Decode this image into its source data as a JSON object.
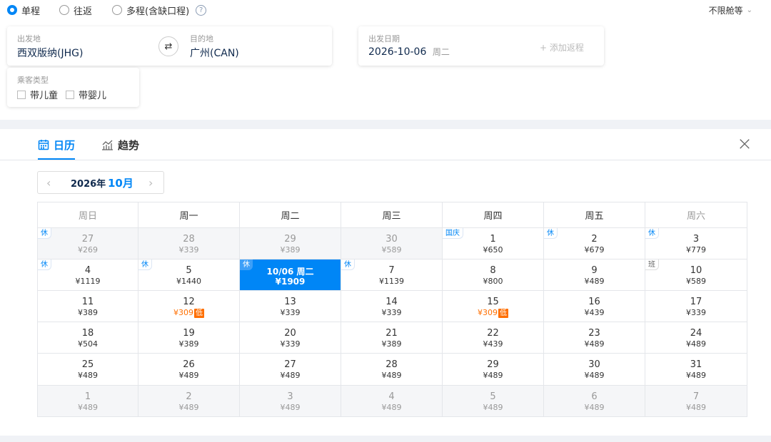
{
  "trip_types": [
    {
      "label": "单程",
      "selected": true
    },
    {
      "label": "往返",
      "selected": false
    },
    {
      "label": "多程(含缺口程)",
      "selected": false
    }
  ],
  "help_label": "?",
  "cabin_label": "不限舱等",
  "search": {
    "origin_label": "出发地",
    "origin": "西双版纳(JHG)",
    "dest_label": "目的地",
    "dest": "广州(CAN)",
    "date_label": "出发日期",
    "date": "2026-10-06",
    "date_weekday": "周二",
    "add_return": "+ 添加返程"
  },
  "passenger": {
    "label": "乘客类型",
    "child": "带儿童",
    "infant": "带婴儿"
  },
  "tabs": [
    {
      "label": "日历",
      "active": true
    },
    {
      "label": "趋势",
      "active": false
    }
  ],
  "month_nav": {
    "year": "2026年",
    "month": "10月"
  },
  "weekdays": [
    "周日",
    "周一",
    "周二",
    "周三",
    "周四",
    "周五",
    "周六"
  ],
  "calendar": [
    [
      {
        "day": "27",
        "price": "¥269",
        "dim": true,
        "tag": "休"
      },
      {
        "day": "28",
        "price": "¥339",
        "dim": true
      },
      {
        "day": "29",
        "price": "¥389",
        "dim": true
      },
      {
        "day": "30",
        "price": "¥589",
        "dim": true
      },
      {
        "day": "1",
        "price": "¥650",
        "tag": "国庆"
      },
      {
        "day": "2",
        "price": "¥679",
        "tag": "休"
      },
      {
        "day": "3",
        "price": "¥779",
        "tag": "休"
      }
    ],
    [
      {
        "day": "4",
        "price": "¥1119",
        "tag": "休"
      },
      {
        "day": "5",
        "price": "¥1440",
        "tag": "休"
      },
      {
        "day": "10/06 周二",
        "price": "¥1909",
        "tag": "休",
        "selected": true
      },
      {
        "day": "7",
        "price": "¥1139",
        "tag": "休"
      },
      {
        "day": "8",
        "price": "¥800"
      },
      {
        "day": "9",
        "price": "¥489"
      },
      {
        "day": "10",
        "price": "¥589",
        "tag": "班"
      }
    ],
    [
      {
        "day": "11",
        "price": "¥389"
      },
      {
        "day": "12",
        "price": "¥309",
        "low": "低"
      },
      {
        "day": "13",
        "price": "¥339"
      },
      {
        "day": "14",
        "price": "¥339"
      },
      {
        "day": "15",
        "price": "¥309",
        "low": "低"
      },
      {
        "day": "16",
        "price": "¥439"
      },
      {
        "day": "17",
        "price": "¥339"
      }
    ],
    [
      {
        "day": "18",
        "price": "¥504"
      },
      {
        "day": "19",
        "price": "¥389"
      },
      {
        "day": "20",
        "price": "¥339"
      },
      {
        "day": "21",
        "price": "¥389"
      },
      {
        "day": "22",
        "price": "¥439"
      },
      {
        "day": "23",
        "price": "¥489"
      },
      {
        "day": "24",
        "price": "¥489"
      }
    ],
    [
      {
        "day": "25",
        "price": "¥489"
      },
      {
        "day": "26",
        "price": "¥489"
      },
      {
        "day": "27",
        "price": "¥489"
      },
      {
        "day": "28",
        "price": "¥489"
      },
      {
        "day": "29",
        "price": "¥489"
      },
      {
        "day": "30",
        "price": "¥489"
      },
      {
        "day": "31",
        "price": "¥489"
      }
    ],
    [
      {
        "day": "1",
        "price": "¥489",
        "dim": true
      },
      {
        "day": "2",
        "price": "¥489",
        "dim": true
      },
      {
        "day": "3",
        "price": "¥489",
        "dim": true
      },
      {
        "day": "4",
        "price": "¥489",
        "dim": true
      },
      {
        "day": "5",
        "price": "¥489",
        "dim": true
      },
      {
        "day": "6",
        "price": "¥489",
        "dim": true
      },
      {
        "day": "7",
        "price": "¥489",
        "dim": true
      }
    ]
  ],
  "colors": {
    "accent": "#0086f6",
    "low_price": "#ff6f00",
    "text_dark": "#0f294d"
  }
}
